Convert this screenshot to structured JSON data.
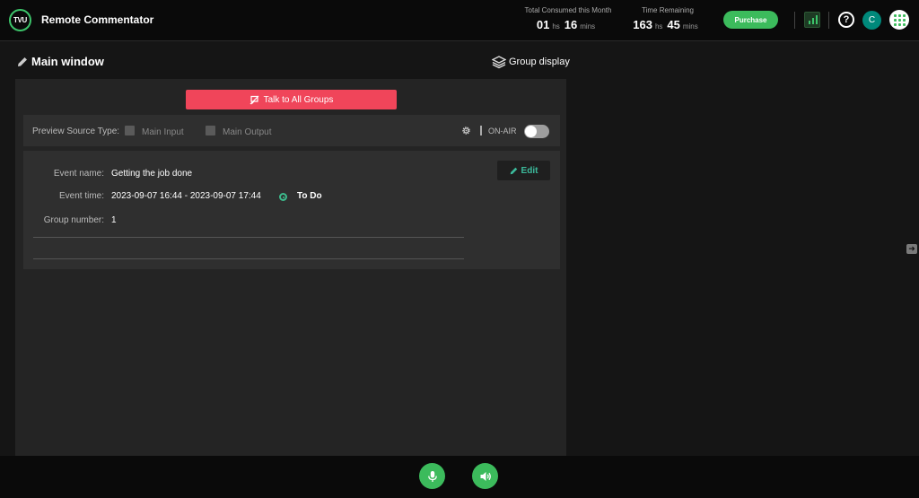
{
  "app": {
    "logo_text": "TVU",
    "title": "Remote Commentator"
  },
  "header": {
    "consumed": {
      "label": "Total Consumed this Month",
      "hours": "01",
      "hours_unit": "hs",
      "mins": "16",
      "mins_unit": "mins"
    },
    "remaining": {
      "label": "Time Remaining",
      "hours": "163",
      "hours_unit": "hs",
      "mins": "45",
      "mins_unit": "mins"
    },
    "purchase_label": "Purchase",
    "help_glyph": "?",
    "avatar_initial": "C",
    "icons": [
      "bar-chart-icon",
      "help-icon",
      "avatar",
      "apps-grid-icon"
    ],
    "accent_color": "#3cbb5c"
  },
  "main": {
    "title": "Main window",
    "group_display_label": "Group display",
    "talk_button_label": "Talk to All Groups",
    "talk_button_color": "#f0455a"
  },
  "preview": {
    "label": "Preview Source Type:",
    "options": [
      "Main Input",
      "Main Output"
    ],
    "onair_label": "ON-AIR",
    "onair_on": false
  },
  "event": {
    "name_label": "Event name:",
    "name": "Getting the job done",
    "time_label": "Event time:",
    "time": "2023-09-07 16:44 - 2023-09-07 17:44",
    "status": "To Do",
    "group_label": "Group number:",
    "group": "1",
    "edit_label": "Edit"
  },
  "side": {
    "arrow_glyph": "➜"
  },
  "footer": {
    "icons": [
      "microphone-icon",
      "speaker-icon"
    ]
  }
}
